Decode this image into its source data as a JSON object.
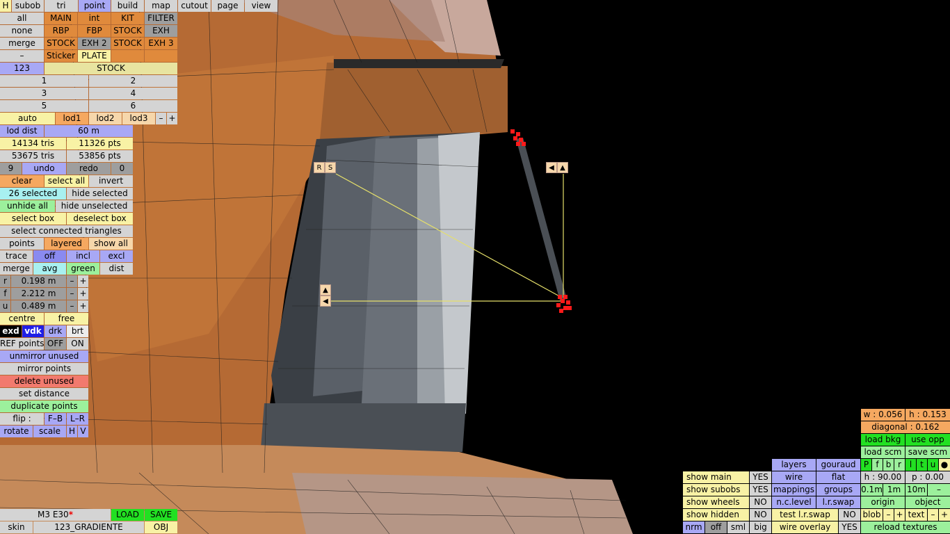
{
  "top_tabs": [
    "H",
    "subob",
    "tri",
    "point",
    "build",
    "map",
    "cutout",
    "page",
    "view"
  ],
  "left": {
    "r1": [
      "all",
      "MAIN",
      "int",
      "KIT",
      "FILTER"
    ],
    "r2": [
      "none",
      "RBP",
      "FBP",
      "STOCK",
      "EXH"
    ],
    "r3": [
      "merge",
      "STOCK",
      "EXH 2",
      "STOCK",
      "EXH 3"
    ],
    "r4": [
      "–",
      "Sticker",
      "PLATE",
      "",
      ""
    ],
    "r5": [
      "123",
      "STOCK"
    ],
    "nums": [
      "1",
      "2",
      "3",
      "4",
      "5",
      "6"
    ],
    "lod": [
      "auto",
      "lod1",
      "lod2",
      "lod3",
      "–",
      "+"
    ],
    "lod_dist_label": "lod dist",
    "lod_dist_val": "60 m",
    "tris1": "14134 tris",
    "pts1": "11326 pts",
    "tris2": "53675 tris",
    "pts2": "53856 pts",
    "undo_row": [
      "9",
      "undo",
      "redo",
      "0"
    ],
    "clear_row": [
      "clear",
      "select all",
      "invert"
    ],
    "sel_row": [
      "26 selected",
      "hide selected"
    ],
    "unhide_row": [
      "unhide all",
      "hide unselected"
    ],
    "box_row": [
      "select box",
      "deselect box"
    ],
    "connected": "select connected triangles",
    "points_row": [
      "points",
      "layered",
      "show all"
    ],
    "trace_row": [
      "trace",
      "off",
      "incl",
      "excl"
    ],
    "merge_row": [
      "merge",
      "avg",
      "green",
      "dist"
    ],
    "coords": [
      {
        "l": "r",
        "v": "0.198 m"
      },
      {
        "l": "f",
        "v": "2.212 m"
      },
      {
        "l": "u",
        "v": "0.489 m"
      }
    ],
    "pm": [
      "–",
      "+"
    ],
    "centre_row": [
      "centre",
      "free"
    ],
    "exd_row": [
      "exd",
      "vdk",
      "drk",
      "brt"
    ],
    "ref_row": [
      "REF points",
      "OFF",
      "ON"
    ],
    "unmirror": "unmirror unused",
    "mirror": "mirror points",
    "delete": "delete unused",
    "setdist": "set distance",
    "duplicate": "duplicate points",
    "flip_row": [
      "flip :",
      "F–B",
      "L–R"
    ],
    "rot_row": [
      "rotate",
      "scale",
      "H",
      "V"
    ]
  },
  "bottom_left": {
    "name": "M3 E30",
    "star": "*",
    "load": "LOAD",
    "save": "SAVE",
    "skin": "skin",
    "texture": "123_GRADIENTE",
    "obj": "OBJ"
  },
  "viewport": {
    "rs": [
      "R",
      "S"
    ],
    "arrows_tr": [
      "◀",
      "▲"
    ],
    "arrows_l": [
      "▲",
      "◀"
    ]
  },
  "right": {
    "w": "w : 0.056",
    "h": "h : 0.153",
    "diag": "diagonal : 0.162",
    "loadbkg": "load bkg",
    "useopp": "use opp",
    "loadscm": "load scm",
    "savescm": "save scm",
    "pfbr": [
      "P",
      "f",
      "b",
      "r",
      "l",
      "t",
      "u",
      "●"
    ],
    "hval": "h : 90.00",
    "pval": "p : 0.00",
    "steps": [
      "0.1m",
      "1m",
      "10m",
      "–"
    ],
    "origin": "origin",
    "object": "object",
    "blob": [
      "blob",
      "–",
      "+"
    ],
    "text": [
      "text",
      "–",
      "+"
    ],
    "reload": "reload textures",
    "layers": "layers",
    "gouraud": "gouraud",
    "wire": "wire",
    "flat": "flat",
    "mappings": "mappings",
    "groups": "groups",
    "nclevel": "n.c.level",
    "lrswap": "l.r.swap",
    "testlr": "test l.r.swap",
    "testlr_val": "NO",
    "wireoverlay": "wire overlay",
    "wireoverlay_val": "YES",
    "shows": [
      {
        "l": "show main",
        "v": "YES"
      },
      {
        "l": "show subobs",
        "v": "YES"
      },
      {
        "l": "show wheels",
        "v": "NO"
      },
      {
        "l": "show hidden",
        "v": "NO"
      }
    ],
    "nrm_row": [
      "nrm",
      "off",
      "sml",
      "big"
    ]
  }
}
